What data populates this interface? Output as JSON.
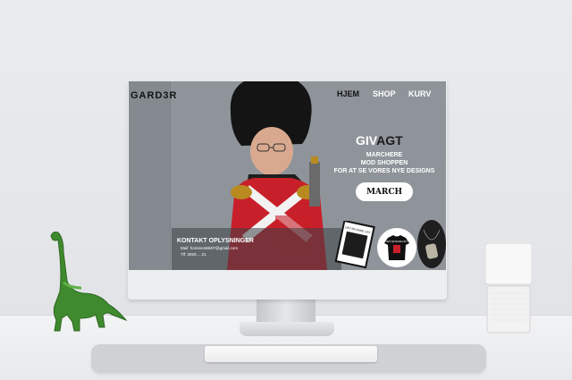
{
  "site": {
    "logo": "GARD3R",
    "nav": [
      {
        "label": "HJEM",
        "active": true
      },
      {
        "label": "SHOP",
        "active": false
      },
      {
        "label": "KURV",
        "active": false
      }
    ]
  },
  "promo": {
    "title_part1": "GIV",
    "title_part2": "AGT",
    "line1": "MARCHERE",
    "line2": "MOD SHOPPEN",
    "line3": "FOR AT SE VORES NYE DESIGNS",
    "button_label": "MARCH"
  },
  "contact": {
    "heading": "KONTAKT OPLYSNINGER",
    "mail": "Mail: hommes684l7@gmail.com",
    "phone": "Tlf: 2929.....21"
  },
  "products": [
    {
      "name": "poster-print",
      "caption": "DET ER BARE LIDT"
    },
    {
      "name": "t-shirt",
      "caption": "DET ER BARE LIDT"
    },
    {
      "name": "dog-tag-necklace"
    }
  ],
  "colors": {
    "screen_bg": "#8e949a",
    "accent_red": "#c8202a",
    "button_bg": "#ffffff",
    "nav_active": "#111111"
  }
}
